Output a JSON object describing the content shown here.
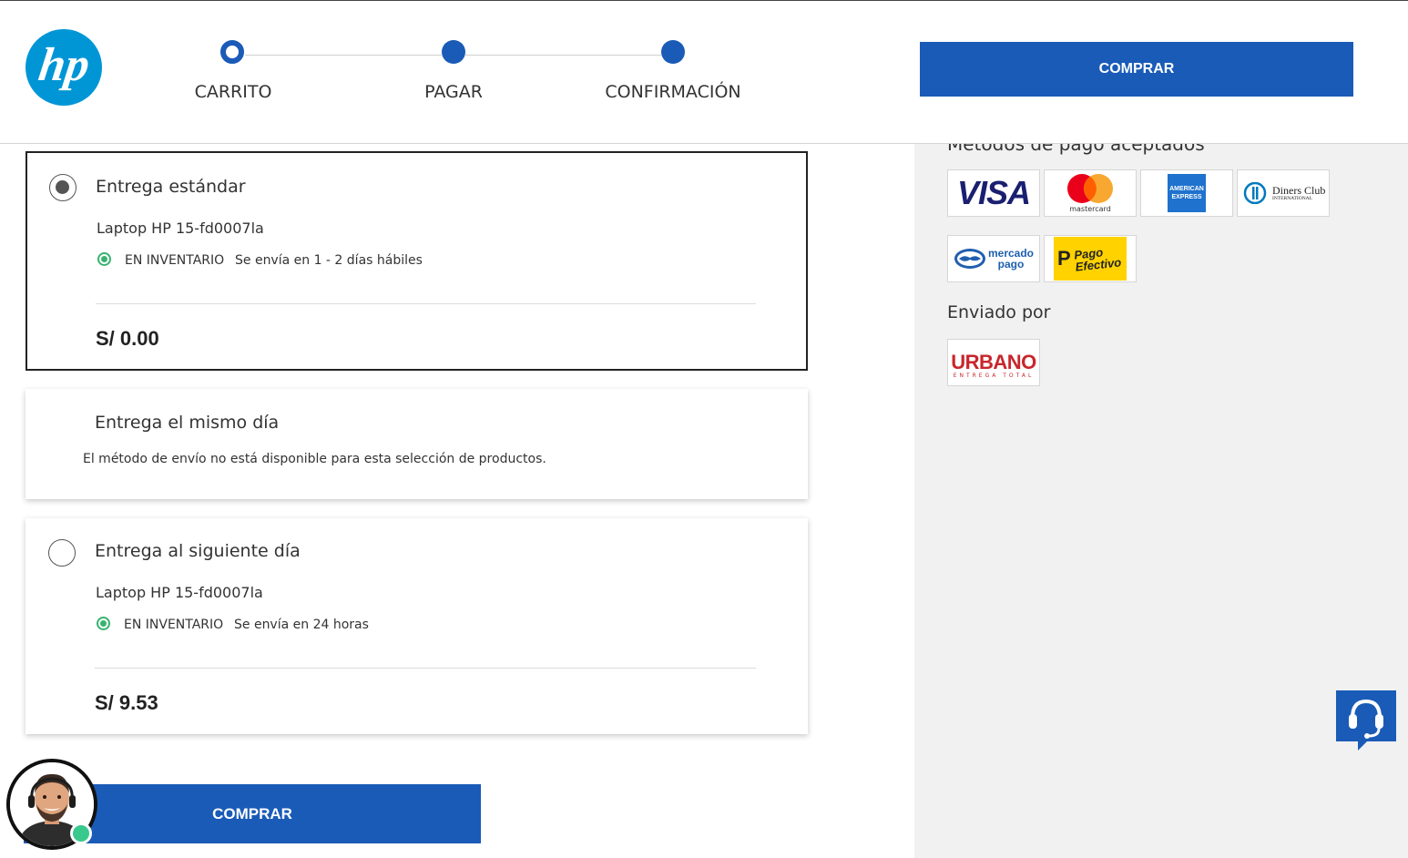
{
  "header": {
    "logo_text": "hp",
    "steps": [
      {
        "label": "CARRITO"
      },
      {
        "label": "PAGAR"
      },
      {
        "label": "CONFIRMACIÓN"
      }
    ],
    "buy_label": "COMPRAR"
  },
  "shipping": {
    "standard": {
      "title": "Entrega estándar",
      "product": "Laptop HP 15-fd0007la",
      "stock": "EN INVENTARIO",
      "eta": "Se envía en 1 - 2 días hábiles",
      "price": "S/ 0.00",
      "selected": true
    },
    "same_day": {
      "title": "Entrega el mismo día",
      "message": "El método de envío no está disponible para esta selección de productos."
    },
    "next_day": {
      "title": "Entrega al siguiente día",
      "product": "Laptop HP 15-fd0007la",
      "stock": "EN INVENTARIO",
      "eta": "Se envía en 24 horas",
      "price": "S/ 9.53",
      "selected": false
    }
  },
  "payment": {
    "title": "Métodos de pago aceptados",
    "methods": [
      {
        "name": "visa",
        "text": "VISA"
      },
      {
        "name": "mastercard",
        "text": "mastercard"
      },
      {
        "name": "american-express",
        "text": "AMERICAN EXPRESS"
      },
      {
        "name": "diners-club",
        "text": "Diners Club",
        "sub": "INTERNATIONAL"
      },
      {
        "name": "mercado-pago",
        "text": "mercado",
        "sub": "pago"
      },
      {
        "name": "pago-efectivo",
        "text": "Pago",
        "sub": "Efectivo"
      }
    ]
  },
  "shipper": {
    "title": "Enviado por",
    "name": "URBANO",
    "tagline": "ENTREGA TOTAL"
  },
  "footer": {
    "buy_label": "COMPRAR"
  },
  "colors": {
    "primary": "#1a5bb7",
    "hp_blue": "#0096d6",
    "in_stock": "#38b36f",
    "panel_bg": "#f1f1f1"
  }
}
